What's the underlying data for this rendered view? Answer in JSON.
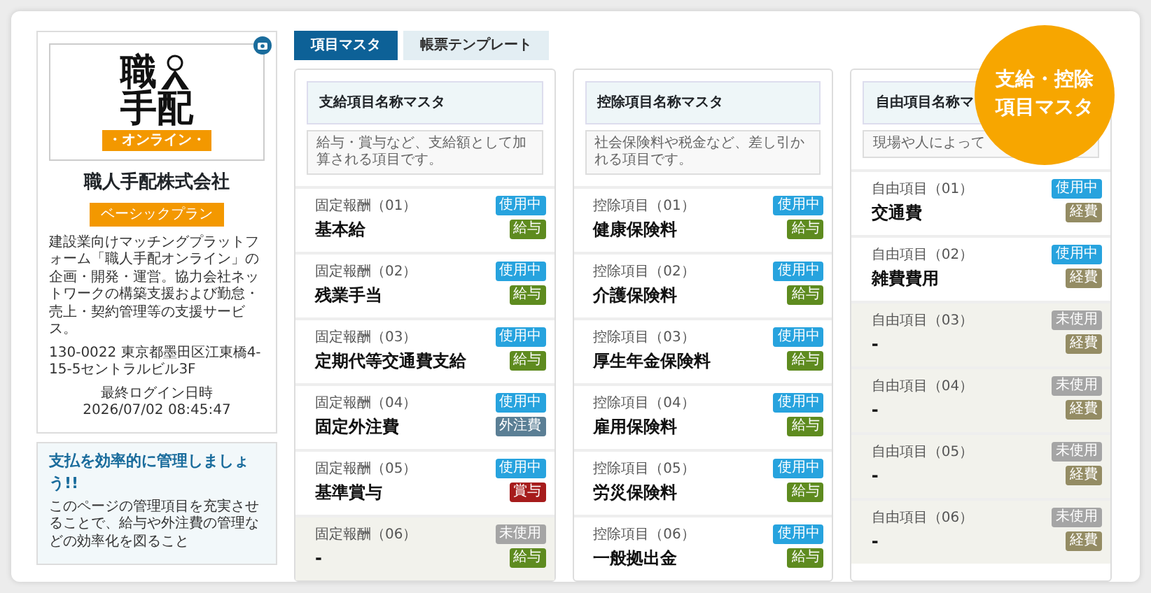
{
  "sidebar": {
    "logo": {
      "line1": "職",
      "line2": "手配",
      "band": "・オンライン・"
    },
    "company_name": "職人手配株式会社",
    "plan": "ベーシックプラン",
    "description": "建設業向けマッチングプラットフォーム「職人手配オンライン」の企画・開発・運営。協力会社ネットワークの構築支援および勤怠・売上・契約管理等の支援サービス。",
    "address": "130-0022 東京都墨田区江東橋4-15-5セントラルビル3F",
    "last_login_label": "最終ログイン日時",
    "last_login": "2026/07/02 08:45:47",
    "tip": {
      "title": "支払を効率的に管理しましょう!!",
      "text": "このページの管理項目を充実させることで、給与や外注費の管理などの効率化を図ること"
    }
  },
  "tabs": [
    {
      "label": "項目マスタ",
      "selected": true
    },
    {
      "label": "帳票テンプレート",
      "selected": false
    }
  ],
  "columns": [
    {
      "title": "支給項目名称マスタ",
      "description": "給与・賞与など、支給額として加算される項目です。",
      "items": [
        {
          "label": "固定報酬（01）",
          "name": "基本給",
          "in_use": true,
          "status": "使用中",
          "category": {
            "text": "給与",
            "kind": "salary"
          }
        },
        {
          "label": "固定報酬（02）",
          "name": "残業手当",
          "in_use": true,
          "status": "使用中",
          "category": {
            "text": "給与",
            "kind": "salary"
          }
        },
        {
          "label": "固定報酬（03）",
          "name": "定期代等交通費支給",
          "in_use": true,
          "status": "使用中",
          "category": {
            "text": "給与",
            "kind": "salary"
          }
        },
        {
          "label": "固定報酬（04）",
          "name": "固定外注費",
          "in_use": true,
          "status": "使用中",
          "category": {
            "text": "外注費",
            "kind": "outsourcing"
          }
        },
        {
          "label": "固定報酬（05）",
          "name": "基準賞与",
          "in_use": true,
          "status": "使用中",
          "category": {
            "text": "賞与",
            "kind": "bonus"
          }
        },
        {
          "label": "固定報酬（06）",
          "name": "-",
          "in_use": false,
          "status": "未使用",
          "category": {
            "text": "給与",
            "kind": "salary"
          }
        }
      ]
    },
    {
      "title": "控除項目名称マスタ",
      "description": "社会保険料や税金など、差し引かれる項目です。",
      "items": [
        {
          "label": "控除項目（01）",
          "name": "健康保険料",
          "in_use": true,
          "status": "使用中",
          "category": {
            "text": "給与",
            "kind": "salary"
          }
        },
        {
          "label": "控除項目（02）",
          "name": "介護保険料",
          "in_use": true,
          "status": "使用中",
          "category": {
            "text": "給与",
            "kind": "salary"
          }
        },
        {
          "label": "控除項目（03）",
          "name": "厚生年金保険料",
          "in_use": true,
          "status": "使用中",
          "category": {
            "text": "給与",
            "kind": "salary"
          }
        },
        {
          "label": "控除項目（04）",
          "name": "雇用保険料",
          "in_use": true,
          "status": "使用中",
          "category": {
            "text": "給与",
            "kind": "salary"
          }
        },
        {
          "label": "控除項目（05）",
          "name": "労災保険料",
          "in_use": true,
          "status": "使用中",
          "category": {
            "text": "給与",
            "kind": "salary"
          }
        },
        {
          "label": "控除項目（06）",
          "name": "一般拠出金",
          "in_use": true,
          "status": "使用中",
          "category": {
            "text": "給与",
            "kind": "salary"
          }
        }
      ]
    },
    {
      "title": "自由項目名称マ",
      "description": "現場や人によって",
      "items": [
        {
          "label": "自由項目（01）",
          "name": "交通費",
          "in_use": true,
          "status": "使用中",
          "category": {
            "text": "経費",
            "kind": "expense"
          }
        },
        {
          "label": "自由項目（02）",
          "name": "雑費費用",
          "in_use": true,
          "status": "使用中",
          "category": {
            "text": "経費",
            "kind": "expense"
          }
        },
        {
          "label": "自由項目（03）",
          "name": "-",
          "in_use": false,
          "status": "未使用",
          "category": {
            "text": "経費",
            "kind": "expense"
          }
        },
        {
          "label": "自由項目（04）",
          "name": "-",
          "in_use": false,
          "status": "未使用",
          "category": {
            "text": "経費",
            "kind": "expense"
          }
        },
        {
          "label": "自由項目（05）",
          "name": "-",
          "in_use": false,
          "status": "未使用",
          "category": {
            "text": "経費",
            "kind": "expense"
          }
        },
        {
          "label": "自由項目（06）",
          "name": "-",
          "in_use": false,
          "status": "未使用",
          "category": {
            "text": "経費",
            "kind": "expense"
          }
        }
      ]
    }
  ],
  "callout": {
    "lines": [
      "支給・控除",
      "項目マスタ"
    ]
  }
}
